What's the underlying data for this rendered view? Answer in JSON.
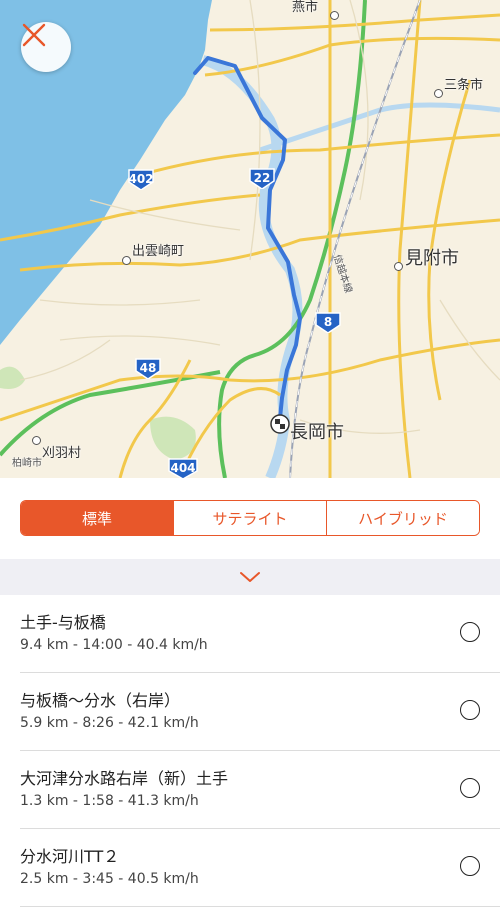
{
  "map": {
    "cities": [
      {
        "id": "tsubame",
        "label": "燕市"
      },
      {
        "id": "sanjo",
        "label": "三条市"
      },
      {
        "id": "izumozaki",
        "label": "出雲崎町"
      },
      {
        "id": "mitsuke",
        "label": "見附市"
      },
      {
        "id": "nagaoka",
        "label": "長岡市"
      },
      {
        "id": "kariwa",
        "label": "刈羽村"
      },
      {
        "id": "kashiwazaki",
        "label": "柏崎市"
      }
    ],
    "rail_label": "信越本線",
    "routes": [
      "402",
      "22",
      "8",
      "48",
      "404"
    ],
    "colors": {
      "route_line": "#3a76d8",
      "highway": "#5cc05c",
      "road": "#f2c84b",
      "sea": "#7fc0e6"
    }
  },
  "close_icon": "close-icon",
  "segmented": {
    "options": [
      "標準",
      "サテライト",
      "ハイブリッド"
    ],
    "selected": "標準",
    "accent": "#e8572a"
  },
  "collapse_icon": "chevron-down-icon",
  "segments": [
    {
      "name": "土手-与板橋",
      "stats": "9.4 km - 14:00 - 40.4 km/h"
    },
    {
      "name": "与板橋〜分水（右岸）",
      "stats": "5.9 km - 8:26 - 42.1 km/h"
    },
    {
      "name": "大河津分水路右岸（新）土手",
      "stats": "1.3 km - 1:58 - 41.3 km/h"
    },
    {
      "name": "分水河川TT２",
      "stats": "2.5 km - 3:45 - 40.5 km/h"
    }
  ]
}
